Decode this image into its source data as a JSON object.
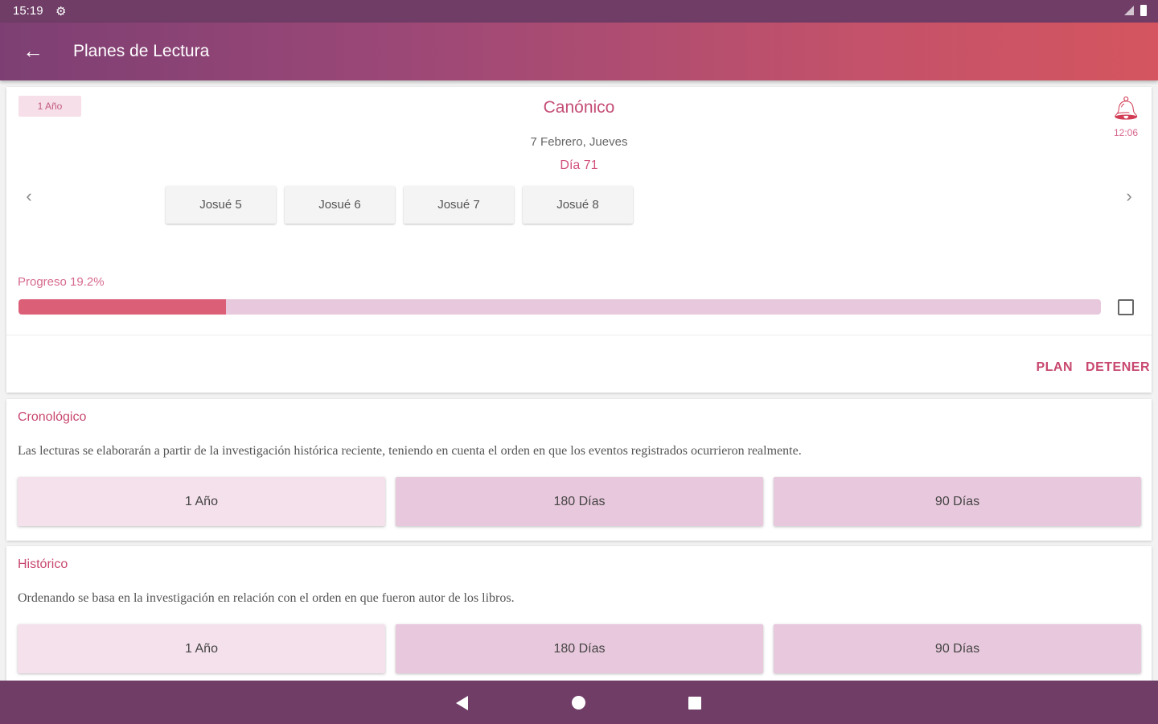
{
  "status_bar": {
    "time": "15:19"
  },
  "app_bar": {
    "title": "Planes de Lectura"
  },
  "current_plan": {
    "tag": "1 Año",
    "name": "Canónico",
    "date": "7 Febrero, Jueves",
    "day": "Día 71",
    "reminder_time": "12:06",
    "chapters": [
      "Josué 5",
      "Josué 6",
      "Josué 7",
      "Josué 8"
    ],
    "progress_label": "Progreso 19.2%",
    "progress_percent": 19.2,
    "actions": {
      "plan": "PLAN",
      "stop": "DETENER"
    }
  },
  "plans": [
    {
      "title": "Cronológico",
      "description": "Las lecturas se elaborarán a partir de la investigación histórica reciente, teniendo en cuenta el orden en que los eventos registrados ocurrieron realmente.",
      "options": [
        "1 Año",
        "180 Días",
        "90 Días"
      ]
    },
    {
      "title": "Histórico",
      "description": "Ordenando se basa en la investigación en relación con el orden en que fueron autor de los libros.",
      "options": [
        "1 Año",
        "180 Días",
        "90 Días"
      ]
    }
  ],
  "colors": {
    "accent": "#c8486f",
    "progress_fill": "#dc5f78",
    "progress_track": "#e8c8dd",
    "bar_dark": "#6f3d66"
  }
}
